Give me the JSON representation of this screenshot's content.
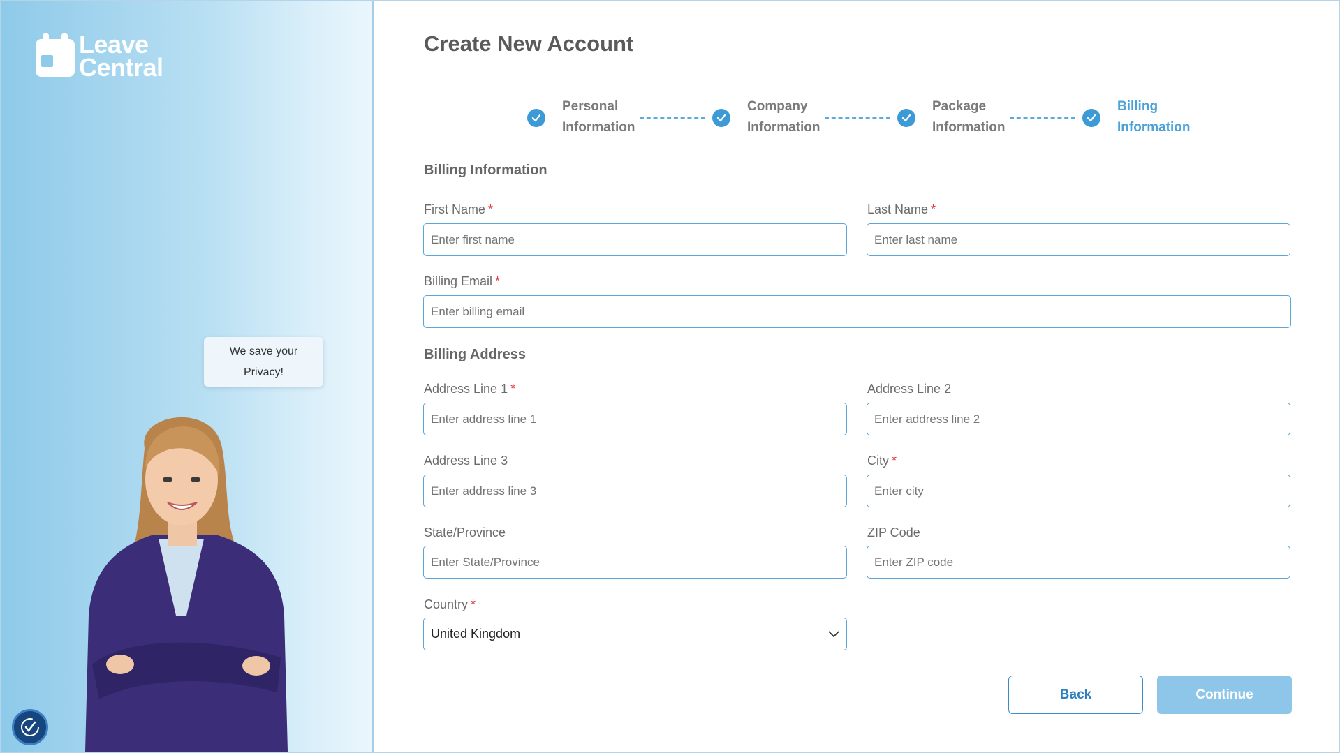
{
  "brand": {
    "name_line1": "Leave",
    "name_line2": "Central"
  },
  "left_panel": {
    "privacy_note_line1": "We save your",
    "privacy_note_line2": "Privacy!"
  },
  "page": {
    "title": "Create New Account"
  },
  "steps": [
    {
      "line1": "Personal",
      "line2": "Information",
      "state": "completed"
    },
    {
      "line1": "Company",
      "line2": "Information",
      "state": "completed"
    },
    {
      "line1": "Package",
      "line2": "Information",
      "state": "completed"
    },
    {
      "line1": "Billing",
      "line2": "Information",
      "state": "active"
    }
  ],
  "billing_info": {
    "heading": "Billing Information",
    "first_name": {
      "label": "First Name",
      "required": "*",
      "placeholder": "Enter first name",
      "value": ""
    },
    "last_name": {
      "label": "Last Name",
      "required": "*",
      "placeholder": "Enter last name",
      "value": ""
    },
    "email": {
      "label": "Billing Email",
      "required": "*",
      "placeholder": "Enter billing email",
      "value": ""
    }
  },
  "billing_address": {
    "heading": "Billing Address",
    "line1": {
      "label": "Address Line 1",
      "required": "*",
      "placeholder": "Enter address line 1"
    },
    "line2": {
      "label": "Address Line 2",
      "placeholder": "Enter address line 2"
    },
    "line3": {
      "label": "Address Line 3",
      "placeholder": "Enter address line 3"
    },
    "city": {
      "label": "City",
      "required": "*",
      "placeholder": "Enter city"
    },
    "state": {
      "label": "State/Province",
      "placeholder": "Enter State/Province"
    },
    "zip": {
      "label": "ZIP Code",
      "placeholder": "Enter ZIP code"
    },
    "country": {
      "label": "Country",
      "required": "*",
      "selected": "United Kingdom"
    }
  },
  "actions": {
    "back": "Back",
    "continue": "Continue"
  },
  "colors": {
    "accent": "#3c9ad6",
    "active_step": "#4aa2d8",
    "required": "#e53939",
    "continue_bg": "#8ec6ea"
  },
  "icons": {
    "steps": "check-circle-icon",
    "country_select": "chevron-down-icon",
    "accessibility": "accessibility-icon",
    "logo": "calendar-icon"
  }
}
